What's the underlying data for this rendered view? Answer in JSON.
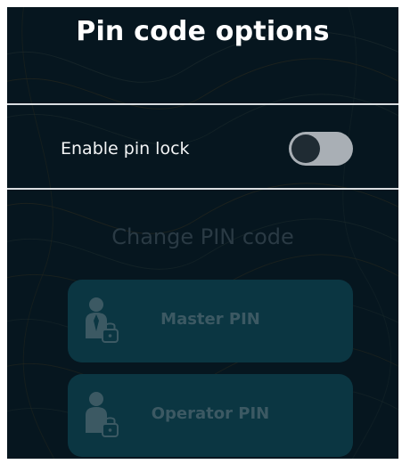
{
  "title": "Pin code options",
  "pin_lock": {
    "label": "Enable pin lock",
    "enabled": false
  },
  "change_pin": {
    "section_title": "Change PIN code",
    "buttons": [
      {
        "label": "Master PIN",
        "icon": "master-user-lock-icon",
        "enabled": false
      },
      {
        "label": "Operator PIN",
        "icon": "operator-user-lock-icon",
        "enabled": false
      }
    ]
  },
  "colors": {
    "background": "#06161f",
    "divider": "#d9dde0",
    "toggle_track": "#a9afb5",
    "toggle_knob": "#1f2b33",
    "disabled_button": "#0b3642",
    "disabled_text": "#3c5963"
  }
}
